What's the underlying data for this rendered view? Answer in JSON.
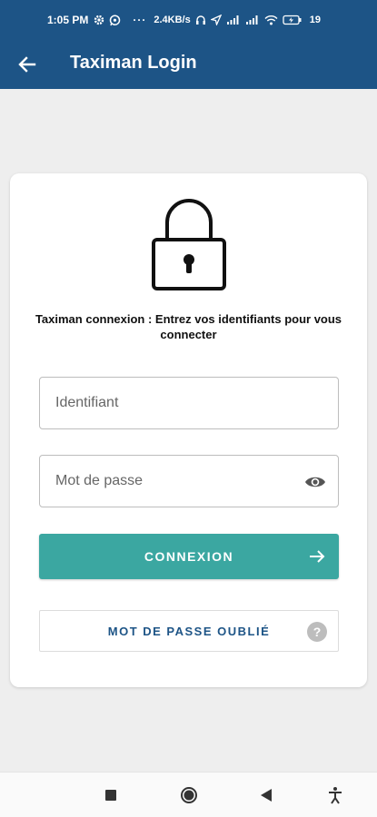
{
  "status_bar": {
    "time": "1:05 PM",
    "dots": "···",
    "network_speed": "2.4KB/s",
    "battery": "19",
    "icons": [
      "gear-icon",
      "whatsapp-icon",
      "headphones-icon",
      "location-arrow-icon",
      "signal-icon",
      "signal-icon",
      "wifi-icon",
      "battery-charging-icon"
    ]
  },
  "app_bar": {
    "title": "Taximan Login",
    "back_icon": "arrow-left-icon",
    "background": "#1d5486"
  },
  "login_card": {
    "lock_icon": "padlock-icon",
    "instruction": "Taximan connexion : Entrez vos identifiants pour vous connecter",
    "username_field": {
      "value": "",
      "placeholder": "Identifiant"
    },
    "password_field": {
      "value": "",
      "placeholder": "Mot de passe",
      "toggle_icon": "eye-icon"
    },
    "login_button": {
      "label": "CONNEXION",
      "icon": "arrow-right-icon",
      "color": "#3ba7a1"
    },
    "forgot_button": {
      "label": "MOT DE PASSE OUBLIÉ",
      "icon": "question-circle-icon",
      "icon_glyph": "?"
    }
  },
  "nav_bar": {
    "buttons": [
      "recent-apps-icon",
      "home-icon",
      "back-triangle-icon",
      "accessibility-icon"
    ]
  }
}
